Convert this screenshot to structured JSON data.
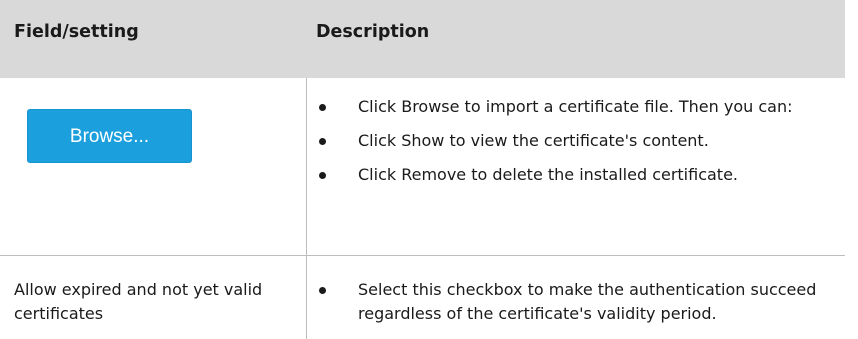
{
  "header": {
    "field_label": "Field/setting",
    "description_label": "Description"
  },
  "rows": [
    {
      "field_button_label": "Browse...",
      "bullets": [
        "Click Browse to import a certificate file. Then you can:",
        "Click Show to view the certificate's content.",
        "Click Remove to delete the installed certificate."
      ]
    },
    {
      "field_text": "Allow expired and not yet valid certificates",
      "bullets": [
        "Select this checkbox to make the authentication succeed regardless of the certificate's validity period."
      ]
    }
  ],
  "colors": {
    "header_bg": "#d9d9d9",
    "button_bg": "#1ba0dd",
    "button_text": "#ffffff",
    "divider": "#bdbdbd"
  }
}
